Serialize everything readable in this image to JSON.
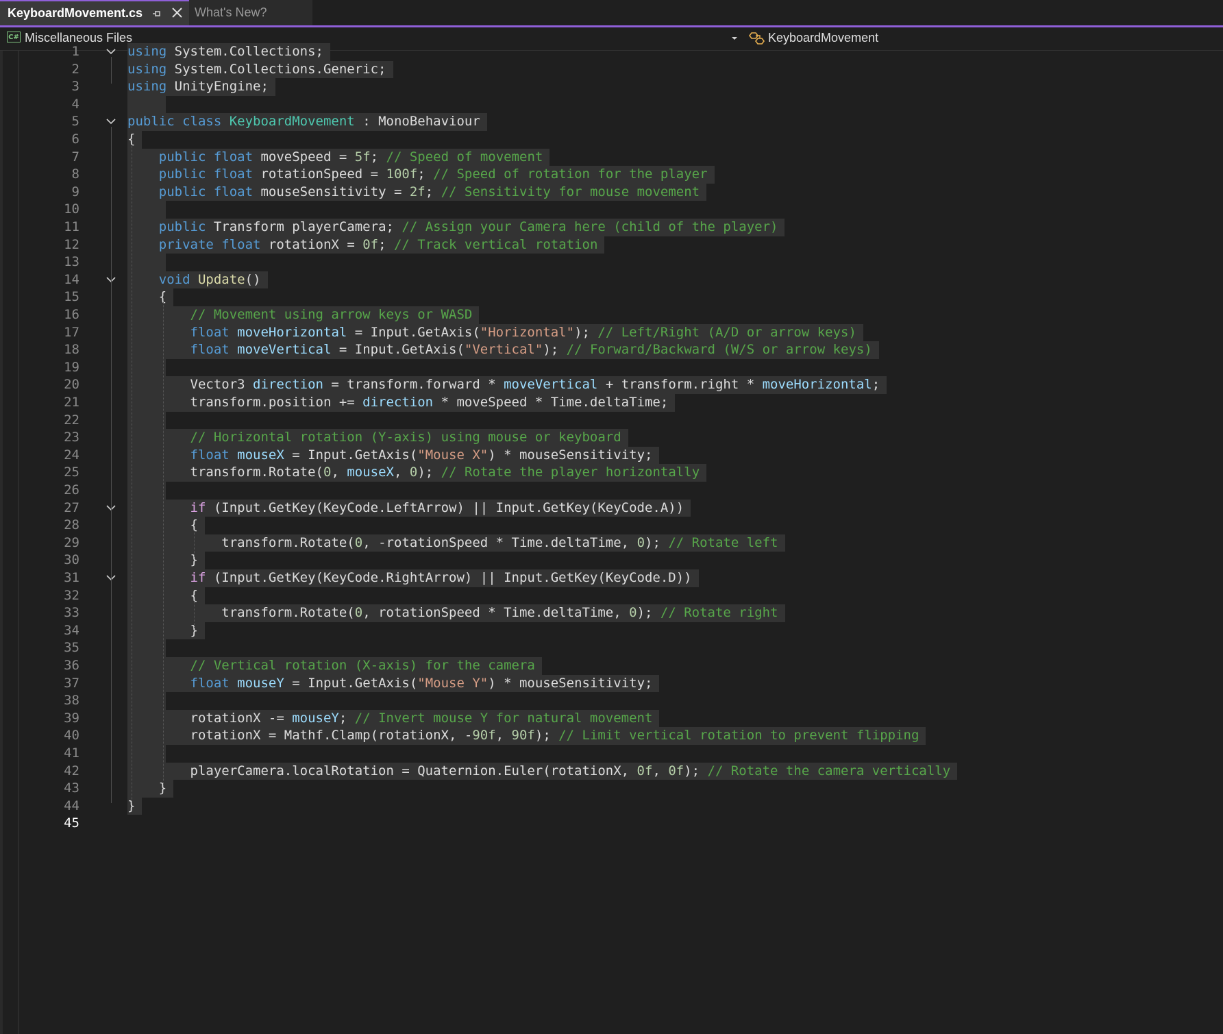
{
  "tabs": [
    {
      "label": "KeyboardMovement.cs",
      "active": true
    },
    {
      "label": "What's New?",
      "active": false
    }
  ],
  "nav": {
    "project": "Miscellaneous Files",
    "member": "KeyboardMovement",
    "project_icon": "csharp-file-icon",
    "member_icon": "class-icon"
  },
  "editor": {
    "current_line": 45,
    "fold_lines": [
      1,
      5,
      14,
      27,
      31
    ],
    "lines": [
      [
        [
          "kw",
          "using"
        ],
        [
          "pl",
          " System.Collections;"
        ]
      ],
      [
        [
          "kw",
          "using"
        ],
        [
          "pl",
          " System.Collections.Generic;"
        ]
      ],
      [
        [
          "kw",
          "using"
        ],
        [
          "pl",
          " UnityEngine;"
        ]
      ],
      [],
      [
        [
          "kw",
          "public class "
        ],
        [
          "typ",
          "KeyboardMovement"
        ],
        [
          "pl",
          " : MonoBehaviour"
        ]
      ],
      [
        [
          "pl",
          "{"
        ]
      ],
      [
        [
          "pl",
          "    "
        ],
        [
          "kw",
          "public float"
        ],
        [
          "pl",
          " moveSpeed = "
        ],
        [
          "num",
          "5f"
        ],
        [
          "pl",
          "; "
        ],
        [
          "com",
          "// Speed of movement"
        ]
      ],
      [
        [
          "pl",
          "    "
        ],
        [
          "kw",
          "public float"
        ],
        [
          "pl",
          " rotationSpeed = "
        ],
        [
          "num",
          "100f"
        ],
        [
          "pl",
          "; "
        ],
        [
          "com",
          "// Speed of rotation for the player"
        ]
      ],
      [
        [
          "pl",
          "    "
        ],
        [
          "kw",
          "public float"
        ],
        [
          "pl",
          " mouseSensitivity = "
        ],
        [
          "num",
          "2f"
        ],
        [
          "pl",
          "; "
        ],
        [
          "com",
          "// Sensitivity for mouse movement"
        ]
      ],
      [],
      [
        [
          "pl",
          "    "
        ],
        [
          "kw",
          "public"
        ],
        [
          "pl",
          " Transform playerCamera; "
        ],
        [
          "com",
          "// Assign your Camera here (child of the player)"
        ]
      ],
      [
        [
          "pl",
          "    "
        ],
        [
          "kw",
          "private float"
        ],
        [
          "pl",
          " rotationX = "
        ],
        [
          "num",
          "0f"
        ],
        [
          "pl",
          "; "
        ],
        [
          "com",
          "// Track vertical rotation"
        ]
      ],
      [],
      [
        [
          "pl",
          "    "
        ],
        [
          "kw",
          "void"
        ],
        [
          "pl",
          " "
        ],
        [
          "fn",
          "Update"
        ],
        [
          "pl",
          "()"
        ]
      ],
      [
        [
          "pl",
          "    {"
        ]
      ],
      [
        [
          "pl",
          "        "
        ],
        [
          "com",
          "// Movement using arrow keys or WASD"
        ]
      ],
      [
        [
          "pl",
          "        "
        ],
        [
          "kw",
          "float"
        ],
        [
          "pl",
          " "
        ],
        [
          "var",
          "moveHorizontal"
        ],
        [
          "pl",
          " = Input.GetAxis("
        ],
        [
          "str",
          "\"Horizontal\""
        ],
        [
          "pl",
          "); "
        ],
        [
          "com",
          "// Left/Right (A/D or arrow keys)"
        ]
      ],
      [
        [
          "pl",
          "        "
        ],
        [
          "kw",
          "float"
        ],
        [
          "pl",
          " "
        ],
        [
          "var",
          "moveVertical"
        ],
        [
          "pl",
          " = Input.GetAxis("
        ],
        [
          "str",
          "\"Vertical\""
        ],
        [
          "pl",
          "); "
        ],
        [
          "com",
          "// Forward/Backward (W/S or arrow keys)"
        ]
      ],
      [],
      [
        [
          "pl",
          "        Vector3 "
        ],
        [
          "var",
          "direction"
        ],
        [
          "pl",
          " = transform.forward * "
        ],
        [
          "var",
          "moveVertical"
        ],
        [
          "pl",
          " + transform.right * "
        ],
        [
          "var",
          "moveHorizontal"
        ],
        [
          "pl",
          ";"
        ]
      ],
      [
        [
          "pl",
          "        transform.position += "
        ],
        [
          "var",
          "direction"
        ],
        [
          "pl",
          " * moveSpeed * Time.deltaTime;"
        ]
      ],
      [],
      [
        [
          "pl",
          "        "
        ],
        [
          "com",
          "// Horizontal rotation (Y-axis) using mouse or keyboard"
        ]
      ],
      [
        [
          "pl",
          "        "
        ],
        [
          "kw",
          "float"
        ],
        [
          "pl",
          " "
        ],
        [
          "var",
          "mouseX"
        ],
        [
          "pl",
          " = Input.GetAxis("
        ],
        [
          "str",
          "\"Mouse X\""
        ],
        [
          "pl",
          ") * mouseSensitivity;"
        ]
      ],
      [
        [
          "pl",
          "        transform.Rotate("
        ],
        [
          "num",
          "0"
        ],
        [
          "pl",
          ", "
        ],
        [
          "var",
          "mouseX"
        ],
        [
          "pl",
          ", "
        ],
        [
          "num",
          "0"
        ],
        [
          "pl",
          "); "
        ],
        [
          "com",
          "// Rotate the player horizontally"
        ]
      ],
      [],
      [
        [
          "pl",
          "        "
        ],
        [
          "ctl",
          "if"
        ],
        [
          "pl",
          " (Input.GetKey(KeyCode.LeftArrow) || Input.GetKey(KeyCode.A))"
        ]
      ],
      [
        [
          "pl",
          "        {"
        ]
      ],
      [
        [
          "pl",
          "            transform.Rotate("
        ],
        [
          "num",
          "0"
        ],
        [
          "pl",
          ", -rotationSpeed * Time.deltaTime, "
        ],
        [
          "num",
          "0"
        ],
        [
          "pl",
          "); "
        ],
        [
          "com",
          "// Rotate left"
        ]
      ],
      [
        [
          "pl",
          "        }"
        ]
      ],
      [
        [
          "pl",
          "        "
        ],
        [
          "ctl",
          "if"
        ],
        [
          "pl",
          " (Input.GetKey(KeyCode.RightArrow) || Input.GetKey(KeyCode.D))"
        ]
      ],
      [
        [
          "pl",
          "        {"
        ]
      ],
      [
        [
          "pl",
          "            transform.Rotate("
        ],
        [
          "num",
          "0"
        ],
        [
          "pl",
          ", rotationSpeed * Time.deltaTime, "
        ],
        [
          "num",
          "0"
        ],
        [
          "pl",
          "); "
        ],
        [
          "com",
          "// Rotate right"
        ]
      ],
      [
        [
          "pl",
          "        }"
        ]
      ],
      [],
      [
        [
          "pl",
          "        "
        ],
        [
          "com",
          "// Vertical rotation (X-axis) for the camera"
        ]
      ],
      [
        [
          "pl",
          "        "
        ],
        [
          "kw",
          "float"
        ],
        [
          "pl",
          " "
        ],
        [
          "var",
          "mouseY"
        ],
        [
          "pl",
          " = Input.GetAxis("
        ],
        [
          "str",
          "\"Mouse Y\""
        ],
        [
          "pl",
          ") * mouseSensitivity;"
        ]
      ],
      [],
      [
        [
          "pl",
          "        rotationX -= "
        ],
        [
          "var",
          "mouseY"
        ],
        [
          "pl",
          "; "
        ],
        [
          "com",
          "// Invert mouse Y for natural movement"
        ]
      ],
      [
        [
          "pl",
          "        rotationX = Mathf.Clamp(rotationX, -"
        ],
        [
          "num",
          "90f"
        ],
        [
          "pl",
          ", "
        ],
        [
          "num",
          "90f"
        ],
        [
          "pl",
          "); "
        ],
        [
          "com",
          "// Limit vertical rotation to prevent flipping"
        ]
      ],
      [],
      [
        [
          "pl",
          "        playerCamera.localRotation = Quaternion.Euler(rotationX, "
        ],
        [
          "num",
          "0f"
        ],
        [
          "pl",
          ", "
        ],
        [
          "num",
          "0f"
        ],
        [
          "pl",
          "); "
        ],
        [
          "com",
          "// Rotate the camera vertically"
        ]
      ],
      [
        [
          "pl",
          "    }"
        ]
      ],
      [
        [
          "pl",
          "}"
        ]
      ],
      null
    ]
  }
}
